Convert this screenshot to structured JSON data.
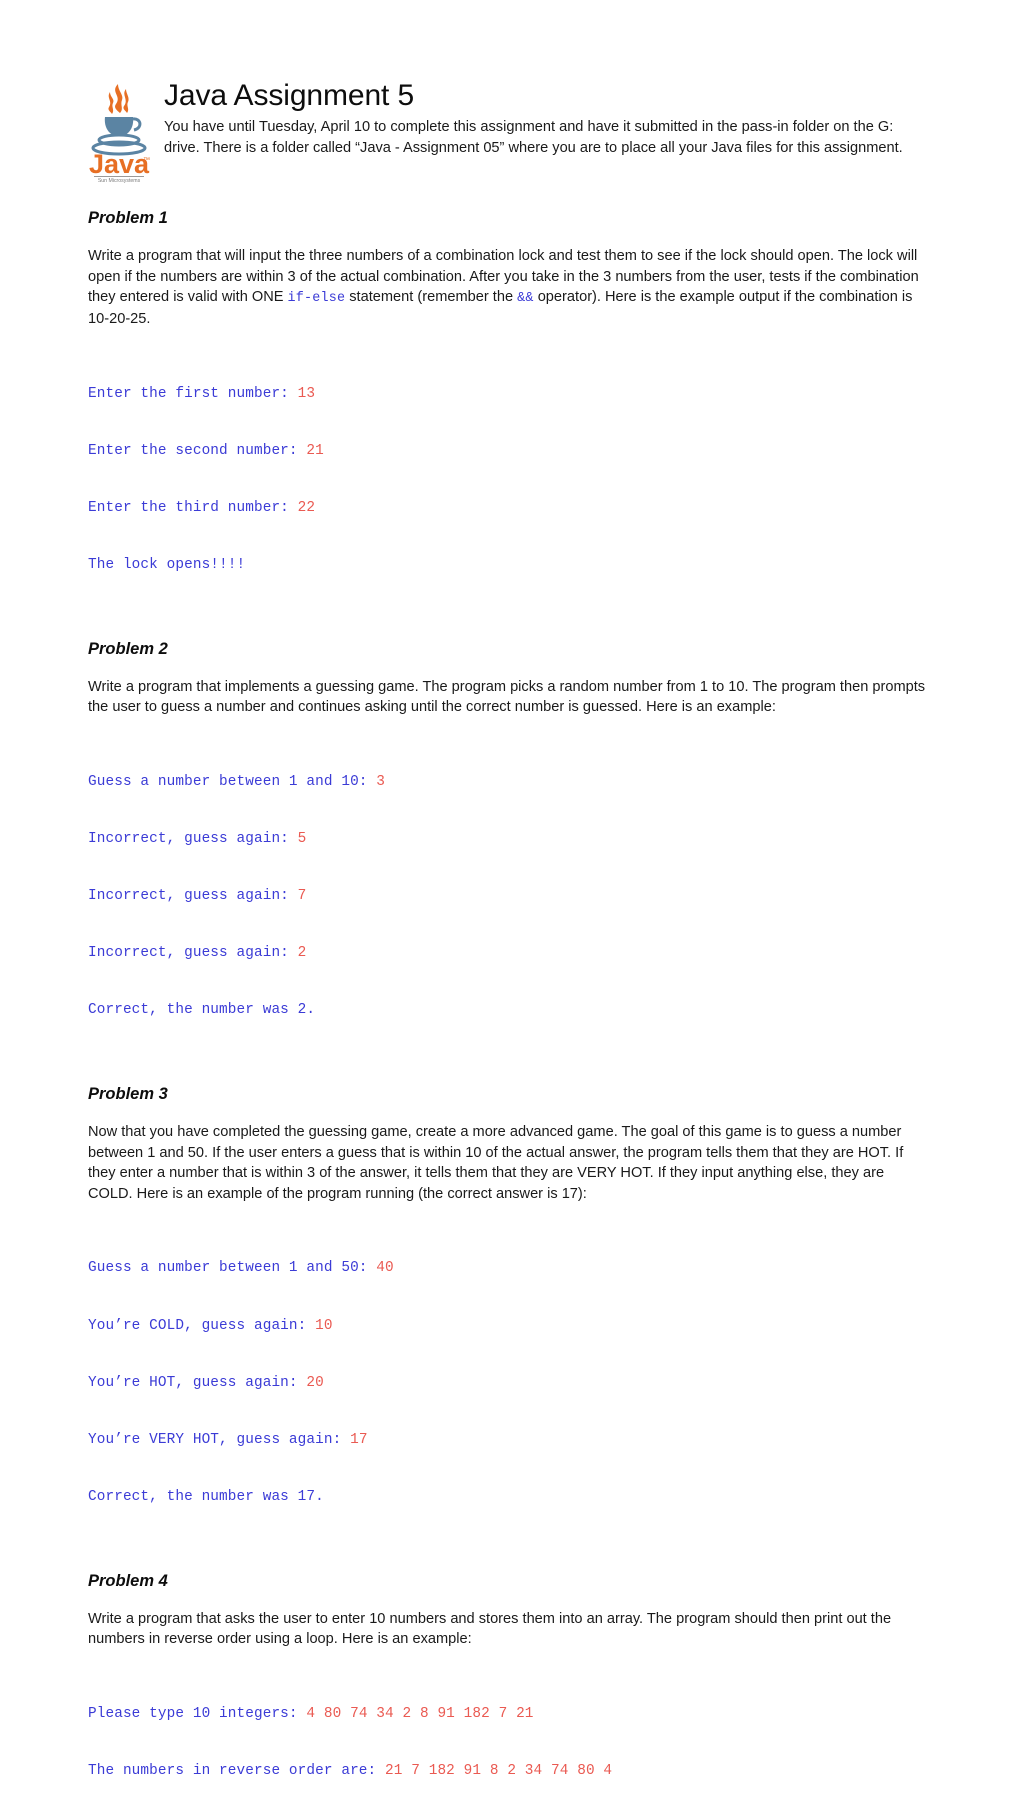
{
  "document": {
    "title": "Java Assignment 5",
    "intro": "You have until Tuesday, April 10 to complete this assignment and have it submitted in the pass-in folder on the G: drive. There is a folder called “Java - Assignment 05” where you are to place all your Java files for this assignment.",
    "logo": {
      "wordmark": "Java",
      "trademark": "™",
      "subtitle": "Sun Microsystems"
    }
  },
  "colors": {
    "console_text": "#3b3bd6",
    "console_input": "#ea5a52",
    "logo_orange": "#e76f24",
    "logo_cup": "#5b84a3",
    "body_text": "#1a1a1a"
  },
  "problems": [
    {
      "heading": "Problem 1",
      "body_part_1": "Write a program that will input the three numbers of a combination lock and test them to see if the lock should open. The lock will open if the numbers are within 3 of the actual combination. After you take in the 3 numbers from the user, tests if the combination they entered is valid with ONE ",
      "code_1": "if-else",
      "body_part_2": " statement (remember the ",
      "code_2": "&&",
      "body_part_3": " operator). Here is the example output if the combination is 10-20-25.",
      "console": [
        {
          "prompt": "Enter the first number: ",
          "input": "13"
        },
        {
          "prompt": "Enter the second number: ",
          "input": "21"
        },
        {
          "prompt": "Enter the third number: ",
          "input": "22"
        },
        {
          "prompt": "The lock opens!!!!",
          "input": ""
        }
      ]
    },
    {
      "heading": "Problem 2",
      "body": "Write a program that implements a guessing game. The program picks a random number from 1 to 10. The program then prompts the user to guess a number and continues asking until the correct number is guessed. Here is an example:",
      "console": [
        {
          "prompt": "Guess a number between 1 and 10: ",
          "input": "3"
        },
        {
          "prompt": "Incorrect, guess again: ",
          "input": "5"
        },
        {
          "prompt": "Incorrect, guess again: ",
          "input": "7"
        },
        {
          "prompt": "Incorrect, guess again: ",
          "input": "2"
        },
        {
          "prompt": "Correct, the number was 2.",
          "input": ""
        }
      ]
    },
    {
      "heading": "Problem 3",
      "body": "Now that you have completed the guessing game, create a more advanced game. The goal of this game is to guess a number between 1 and 50. If the user enters a guess that is within 10 of the actual answer, the program tells them that they are HOT. If they enter a number that is within 3 of the answer, it tells them that they are VERY HOT. If they input anything else, they are COLD. Here is an example of the program running (the correct answer is 17):",
      "console": [
        {
          "prompt": "Guess a number between 1 and 50: ",
          "input": "40"
        },
        {
          "prompt": "You’re COLD, guess again: ",
          "input": "10"
        },
        {
          "prompt": "You’re HOT, guess again: ",
          "input": "20"
        },
        {
          "prompt": "You’re VERY HOT, guess again: ",
          "input": "17"
        },
        {
          "prompt": "Correct, the number was 17.",
          "input": ""
        }
      ]
    },
    {
      "heading": "Problem 4",
      "body": "Write a program that asks the user to enter 10 numbers and stores them into an array. The program should then print out the numbers in reverse order using a loop. Here is an example:",
      "console": [
        {
          "prompt": "Please type 10 integers: ",
          "input": "4 80 74 34 2 8 91 182 7 21"
        },
        {
          "prompt": "The numbers in reverse order are: ",
          "input": "21 7 182 91 8 2 34 74 80 4"
        }
      ]
    }
  ]
}
